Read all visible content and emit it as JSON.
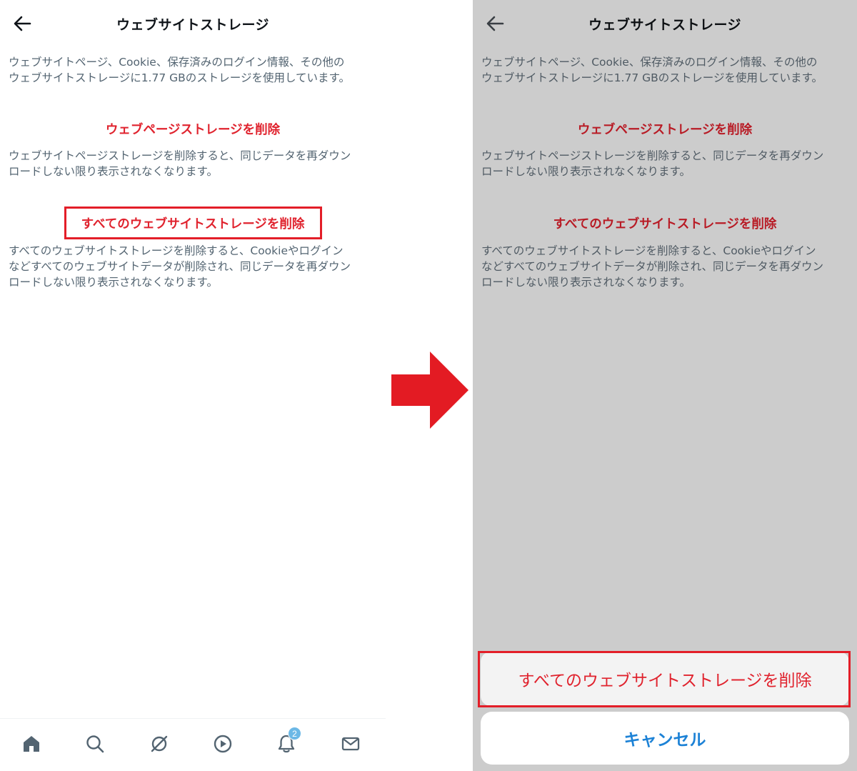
{
  "screen_before": {
    "header": {
      "title": "ウェブサイトストレージ"
    },
    "usage_description": [
      "ウェブサイトページ、Cookie、保存済みのログイン情報、その他の",
      "ウェブサイトストレージに1.77 GBのストレージを使用しています。"
    ],
    "delete_page_storage": {
      "label": "ウェブページストレージを削除",
      "description": [
        "ウェブサイトページストレージを削除すると、同じデータを再ダウン",
        "ロードしない限り表示されなくなります。"
      ]
    },
    "delete_all_storage": {
      "label": "すべてのウェブサイトストレージを削除",
      "description": [
        "すべてのウェブサイトストレージを削除すると、Cookieやログイン",
        "などすべてのウェブサイトデータが削除され、同じデータを再ダウン",
        "ロードしない限り表示されなくなります。"
      ]
    },
    "bottom_nav": {
      "items": [
        "home-icon",
        "search-icon",
        "spaces-icon",
        "video-icon",
        "notifications-icon",
        "messages-icon"
      ],
      "notification_badge": "2"
    }
  },
  "screen_after": {
    "header": {
      "title": "ウェブサイトストレージ"
    },
    "usage_description": [
      "ウェブサイトページ、Cookie、保存済みのログイン情報、その他の",
      "ウェブサイトストレージに1.77 GBのストレージを使用しています。"
    ],
    "delete_page_storage": {
      "label": "ウェブページストレージを削除",
      "description": [
        "ウェブサイトページストレージを削除すると、同じデータを再ダウン",
        "ロードしない限り表示されなくなります。"
      ]
    },
    "delete_all_storage": {
      "label": "すべてのウェブサイトストレージを削除",
      "description": [
        "すべてのウェブサイトストレージを削除すると、Cookieやログイン",
        "などすべてのウェブサイトデータが削除され、同じデータを再ダウン",
        "ロードしない限り表示されなくなります。"
      ]
    },
    "action_sheet": {
      "confirm_label": "すべてのウェブサイトストレージを削除",
      "cancel_label": "キャンセル"
    }
  },
  "colors": {
    "accent_red": "#e0232e",
    "highlight_red": "#e31e28",
    "link_blue": "#1d82d6",
    "dim_overlay": "#cccccc",
    "badge_blue": "#6cb8e6"
  }
}
